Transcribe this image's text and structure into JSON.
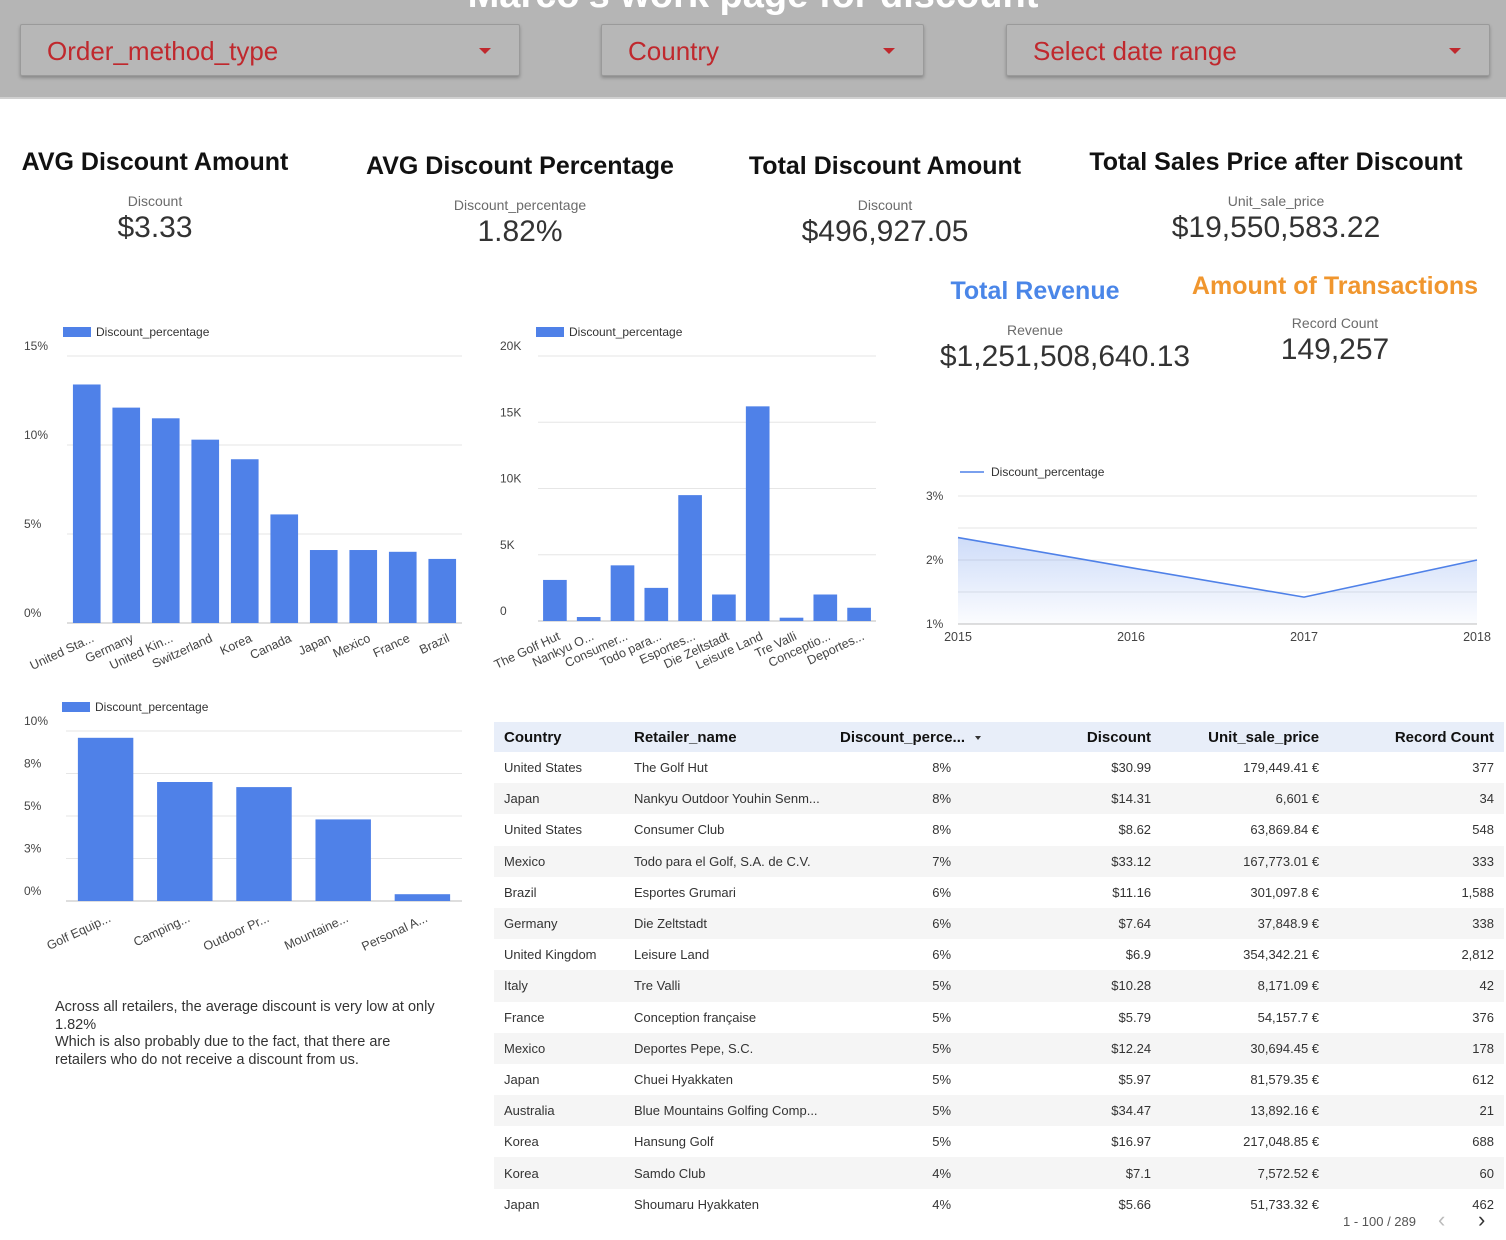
{
  "header": {
    "title": "Marco's work page for discount",
    "dropdowns": [
      {
        "label": "Order_method_type"
      },
      {
        "label": "Country"
      },
      {
        "label": "Select date range"
      }
    ]
  },
  "kpis": [
    {
      "title": "AVG Discount Amount",
      "sub": "Discount",
      "value": "$3.33"
    },
    {
      "title": "AVG Discount Percentage",
      "sub": "Discount_percentage",
      "value": "1.82%"
    },
    {
      "title": "Total Discount Amount",
      "sub": "Discount",
      "value": "$496,927.05"
    },
    {
      "title": "Total Sales Price after Discount",
      "sub": "Unit_sale_price",
      "value": "$19,550,583.22"
    },
    {
      "title": "Total Revenue",
      "sub": "Revenue",
      "value": "$1,251,508,640.13"
    },
    {
      "title": "Amount of Transactions",
      "sub": "Record Count",
      "value": "149,257"
    }
  ],
  "colors": {
    "bar": "#4f81e8",
    "header_bg": "#b5b5b5",
    "dropdown_text": "#c0282d",
    "revenue_title": "#4a86e8",
    "transactions_title": "#f0962e"
  },
  "chart_data": [
    {
      "type": "bar",
      "legend": "Discount_percentage",
      "categories": [
        "United Sta...",
        "Germany",
        "United Kin...",
        "Switzerland",
        "Korea",
        "Canada",
        "Japan",
        "Mexico",
        "France",
        "Brazil"
      ],
      "values": [
        13.4,
        12.1,
        11.5,
        10.3,
        9.2,
        6.1,
        4.1,
        4.1,
        4.0,
        3.6
      ],
      "ylim": [
        0,
        15
      ],
      "yticks": [
        "0%",
        "5%",
        "10%",
        "15%"
      ]
    },
    {
      "type": "bar",
      "legend": "Discount_percentage",
      "categories": [
        "The Golf Hut",
        "Nankyu O...",
        "Consumer...",
        "Todo para...",
        "Esportes...",
        "Die Zeltstadt",
        "Leisure Land",
        "Tre Valli",
        "Conceptio...",
        "Deportes..."
      ],
      "values": [
        3100,
        300,
        4200,
        2500,
        9500,
        2000,
        16200,
        250,
        2000,
        1000
      ],
      "ylim": [
        0,
        20000
      ],
      "yticks": [
        "0",
        "5K",
        "10K",
        "15K",
        "20K"
      ]
    },
    {
      "type": "area",
      "legend": "Discount_percentage",
      "x": [
        "2015",
        "2016",
        "2017",
        "2018"
      ],
      "values": [
        2.35,
        1.88,
        1.42,
        2.0
      ],
      "ylim": [
        1,
        3
      ],
      "yticks": [
        "1%",
        "2%",
        "3%"
      ]
    },
    {
      "type": "bar",
      "legend": "Discount_percentage",
      "categories": [
        "Golf Equip...",
        "Camping...",
        "Outdoor Pr...",
        "Mountaine...",
        "Personal A..."
      ],
      "values": [
        9.6,
        7.0,
        6.7,
        4.8,
        0.4
      ],
      "ylim": [
        0,
        10
      ],
      "yticks": [
        "0%",
        "3%",
        "5%",
        "8%",
        "10%"
      ]
    }
  ],
  "note": {
    "line1": "Across all retailers, the average discount is very low at only 1.82%",
    "line2": "Which is also probably due to the fact, that there are retailers who do not receive a discount from us."
  },
  "table": {
    "columns": [
      "Country",
      "Retailer_name",
      "Discount_perce...",
      "Discount",
      "Unit_sale_price",
      "Record Count"
    ],
    "rows": [
      [
        "United States",
        "The Golf Hut",
        "8%",
        "$30.99",
        "179,449.41 €",
        "377"
      ],
      [
        "Japan",
        "Nankyu Outdoor Youhin Senm...",
        "8%",
        "$14.31",
        "6,601 €",
        "34"
      ],
      [
        "United States",
        "Consumer Club",
        "8%",
        "$8.62",
        "63,869.84 €",
        "548"
      ],
      [
        "Mexico",
        "Todo para el Golf, S.A. de C.V.",
        "7%",
        "$33.12",
        "167,773.01 €",
        "333"
      ],
      [
        "Brazil",
        "Esportes Grumari",
        "6%",
        "$11.16",
        "301,097.8 €",
        "1,588"
      ],
      [
        "Germany",
        "Die Zeltstadt",
        "6%",
        "$7.64",
        "37,848.9 €",
        "338"
      ],
      [
        "United Kingdom",
        "Leisure Land",
        "6%",
        "$6.9",
        "354,342.21 €",
        "2,812"
      ],
      [
        "Italy",
        "Tre Valli",
        "5%",
        "$10.28",
        "8,171.09 €",
        "42"
      ],
      [
        "France",
        "Conception française",
        "5%",
        "$5.79",
        "54,157.7 €",
        "376"
      ],
      [
        "Mexico",
        "Deportes Pepe, S.C.",
        "5%",
        "$12.24",
        "30,694.45 €",
        "178"
      ],
      [
        "Japan",
        "Chuei Hyakkaten",
        "5%",
        "$5.97",
        "81,579.35 €",
        "612"
      ],
      [
        "Australia",
        "Blue Mountains Golfing Comp...",
        "5%",
        "$34.47",
        "13,892.16 €",
        "21"
      ],
      [
        "Korea",
        "Hansung Golf",
        "5%",
        "$16.97",
        "217,048.85 €",
        "688"
      ],
      [
        "Korea",
        "Samdo Club",
        "4%",
        "$7.1",
        "7,572.52 €",
        "60"
      ],
      [
        "Japan",
        "Shoumaru Hyakkaten",
        "4%",
        "$5.66",
        "51,733.32 €",
        "462"
      ]
    ],
    "pagination": "1 - 100 / 289",
    "prev_icon": "‹",
    "next_icon": "›"
  }
}
